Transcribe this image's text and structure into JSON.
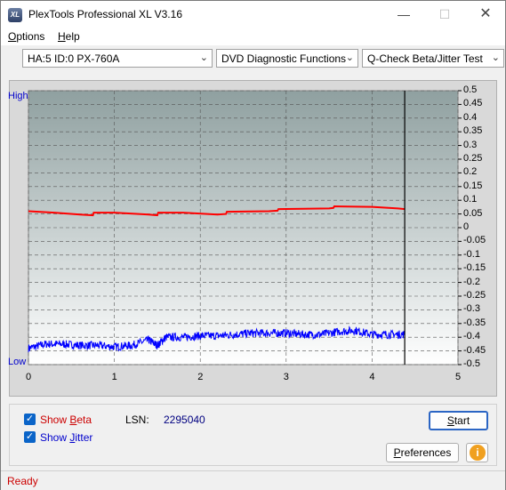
{
  "window": {
    "title": "PlexTools Professional XL V3.16",
    "icon_text": "XL",
    "minimize_glyph": "—",
    "maximize_glyph": "☐",
    "close_glyph": "✕"
  },
  "menu": [
    {
      "accel": "O",
      "rest": "ptions"
    },
    {
      "accel": "H",
      "rest": "elp"
    }
  ],
  "toolbar": {
    "drive_select": "HA:5 ID:0  PX-760A",
    "function_select": "DVD Diagnostic Functions",
    "test_select": "Q-Check Beta/Jitter Test",
    "dropdown_glyph": "⌄"
  },
  "chart": {
    "left_label_top": "High",
    "left_label_bottom": "Low",
    "x_ticks": [
      "0",
      "1",
      "2",
      "3",
      "4",
      "5"
    ],
    "y_ticks": [
      "0.5",
      "0.45",
      "0.4",
      "0.35",
      "0.3",
      "0.25",
      "0.2",
      "0.15",
      "0.1",
      "0.05",
      "0",
      "-0.05",
      "-0.1",
      "-0.15",
      "-0.2",
      "-0.25",
      "-0.3",
      "-0.35",
      "-0.4",
      "-0.45",
      "-0.5"
    ],
    "colors": {
      "beta": "#ff0000",
      "jitter": "#0000ff",
      "bg_top": "#94a4a4",
      "bg_bottom": "#ffffff"
    }
  },
  "chart_data": {
    "type": "line",
    "xlim": [
      0,
      5
    ],
    "ylim": [
      -0.5,
      0.5
    ],
    "grid": true,
    "end_marker_x": 4.38,
    "series": [
      {
        "name": "Beta",
        "x": [
          0,
          0.3,
          0.6,
          0.75,
          0.76,
          1.0,
          1.4,
          1.5,
          1.51,
          1.8,
          2.2,
          2.3,
          2.31,
          2.8,
          2.9,
          2.91,
          3.5,
          3.55,
          3.56,
          4.0,
          4.3,
          4.38
        ],
        "values": [
          0.06,
          0.055,
          0.048,
          0.045,
          0.055,
          0.055,
          0.048,
          0.045,
          0.055,
          0.055,
          0.048,
          0.05,
          0.058,
          0.06,
          0.062,
          0.068,
          0.07,
          0.072,
          0.078,
          0.076,
          0.07,
          0.068
        ]
      },
      {
        "name": "Jitter",
        "x": [
          0,
          0.2,
          0.4,
          0.6,
          0.8,
          1.0,
          1.2,
          1.4,
          1.5,
          1.6,
          1.8,
          2.0,
          2.2,
          2.4,
          2.6,
          2.8,
          3.0,
          3.2,
          3.4,
          3.6,
          3.8,
          4.0,
          4.2,
          4.38
        ],
        "values": [
          -0.44,
          -0.425,
          -0.425,
          -0.43,
          -0.43,
          -0.435,
          -0.43,
          -0.41,
          -0.43,
          -0.4,
          -0.4,
          -0.395,
          -0.395,
          -0.39,
          -0.385,
          -0.385,
          -0.385,
          -0.39,
          -0.39,
          -0.38,
          -0.375,
          -0.39,
          -0.39,
          -0.39
        ]
      }
    ]
  },
  "bottom": {
    "show_beta_prefix": "Show ",
    "show_beta_accel": "B",
    "show_beta_rest": "eta",
    "show_jitter_prefix": "Show ",
    "show_jitter_accel": "J",
    "show_jitter_rest": "itter",
    "check_glyph": "✓",
    "lsn_label": "LSN:",
    "lsn_value": "2295040",
    "start_accel": "S",
    "start_rest": "tart",
    "preferences_pre": "",
    "preferences_accel": "P",
    "preferences_rest": "references",
    "info_glyph": "i"
  },
  "status": {
    "text": "Ready"
  }
}
